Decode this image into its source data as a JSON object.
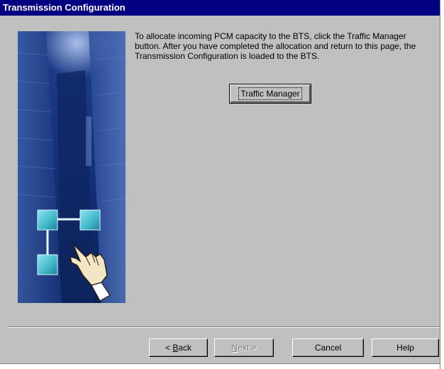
{
  "window": {
    "title": "Transmission Configuration"
  },
  "main": {
    "instructions": "To allocate incoming PCM capacity to the BTS, click the Traffic Manager button. After you have completed the allocation and return to this page, the Transmission Configuration is loaded to the BTS.",
    "traffic_manager_label": "Traffic Manager"
  },
  "footer": {
    "back": {
      "prefix": "< ",
      "mnemonic": "B",
      "rest": "ack"
    },
    "next": {
      "mnemonic": "N",
      "rest": "ext >",
      "enabled": false
    },
    "cancel_label": "Cancel",
    "help_label": "Help"
  },
  "picture": {
    "icon": "network-pointing-hand-icon"
  },
  "colors": {
    "titlebar": "#000080",
    "dialog": "#c0c0c0",
    "node": "#3fb7c8"
  }
}
